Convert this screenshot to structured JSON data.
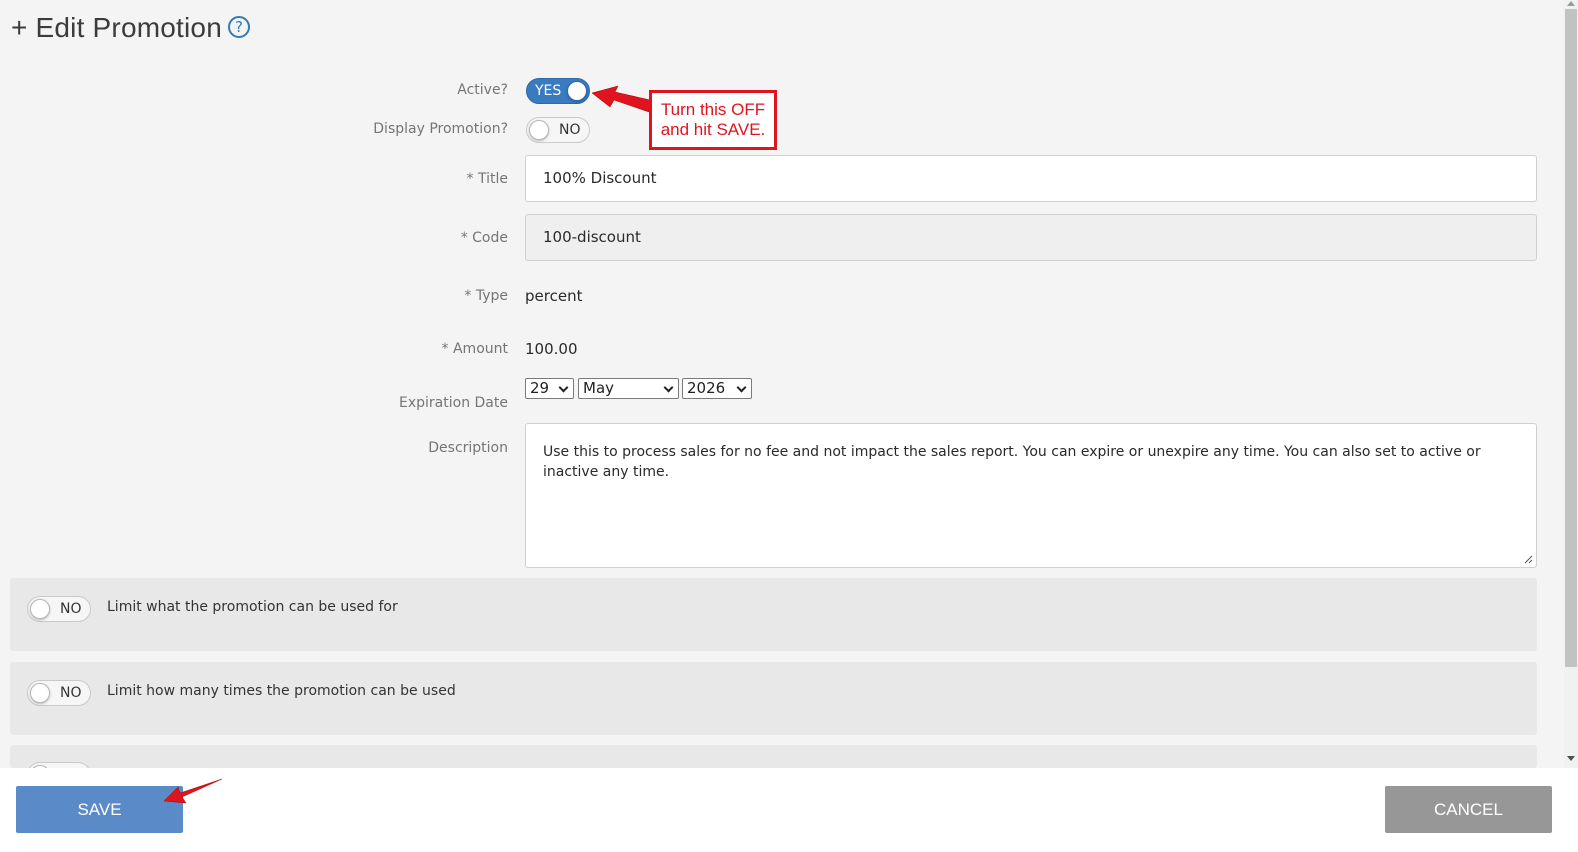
{
  "header": {
    "title": "+ Edit Promotion",
    "help_icon": "?"
  },
  "form": {
    "active": {
      "label": "Active?",
      "state": "YES"
    },
    "display": {
      "label": "Display Promotion?",
      "state": "NO"
    },
    "title": {
      "label": "* Title",
      "value": "100% Discount"
    },
    "code": {
      "label": "* Code",
      "value": "100-discount"
    },
    "type": {
      "label": "* Type",
      "value": "percent"
    },
    "amount": {
      "label": "* Amount",
      "value": "100.00"
    },
    "expiration": {
      "label": "Expiration Date",
      "day": "29",
      "month": "May",
      "year": "2026"
    },
    "description": {
      "label": "Description",
      "value": "Use this to process sales for no fee and not impact the sales report. You can expire or unexpire any time. You can also set to active or inactive any time."
    }
  },
  "sections": [
    {
      "state": "NO",
      "label": "Limit what the promotion can be used for"
    },
    {
      "state": "NO",
      "label": "Limit how many times the promotion can be used"
    }
  ],
  "annotation": {
    "line1": "Turn this OFF",
    "line2": "and hit SAVE."
  },
  "footer": {
    "save_label": "SAVE",
    "cancel_label": "CANCEL"
  },
  "colors": {
    "accent": "#3a7bbf",
    "save": "#5b8ac9",
    "cancel": "#979797",
    "annotation": "#e0141e"
  }
}
